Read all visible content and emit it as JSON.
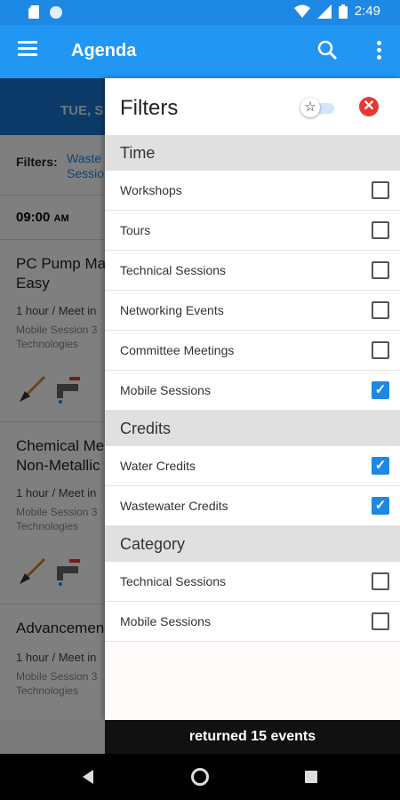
{
  "status_bar": {
    "time": "2:49"
  },
  "app_bar": {
    "title": "Agenda"
  },
  "background": {
    "date_label": "TUE, S",
    "filters_label": "Filters:",
    "filters_value_line1": "Waste",
    "filters_value_line2": "Sessio",
    "time_label": "09:00",
    "time_ampm": "AM",
    "events": [
      {
        "title_line1": "PC Pump Ma",
        "title_line2": "Easy",
        "meta": "1 hour / Meet in",
        "sub_line1": "Mobile Session 3",
        "sub_line2": "Technologies"
      },
      {
        "title_line1": "Chemical Me",
        "title_line2": "Non-Metallic",
        "meta": "1 hour / Meet in",
        "sub_line1": "Mobile Session 3",
        "sub_line2": "Technologies"
      },
      {
        "title_line1": "Advancemen",
        "title_line2": "",
        "meta": "1 hour / Meet in",
        "sub_line1": "Mobile Session 3",
        "sub_line2": "Technologies"
      }
    ]
  },
  "drawer": {
    "title": "Filters",
    "favorites_toggle_on": false,
    "sections": [
      {
        "label": "Time",
        "items": [
          {
            "label": "Workshops",
            "checked": false
          },
          {
            "label": "Tours",
            "checked": false
          },
          {
            "label": "Technical Sessions",
            "checked": false
          },
          {
            "label": "Networking Events",
            "checked": false
          },
          {
            "label": "Committee Meetings",
            "checked": false
          },
          {
            "label": "Mobile Sessions",
            "checked": true
          }
        ]
      },
      {
        "label": "Credits",
        "items": [
          {
            "label": "Water Credits",
            "checked": true
          },
          {
            "label": "Wastewater Credits",
            "checked": true
          }
        ]
      },
      {
        "label": "Category",
        "items": [
          {
            "label": "Technical Sessions",
            "checked": false
          },
          {
            "label": "Mobile Sessions",
            "checked": false
          }
        ]
      }
    ]
  },
  "banner": {
    "text": "returned 15 events"
  },
  "colors": {
    "primary": "#2196f3",
    "status_bar": "#1e88e5",
    "checkbox_checked": "#1e88e5",
    "close": "#e53935"
  }
}
